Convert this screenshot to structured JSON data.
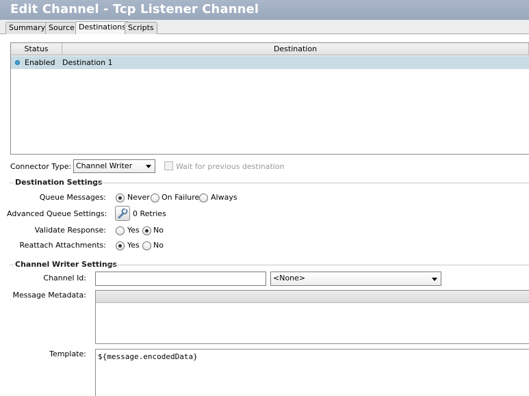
{
  "window": {
    "title": "Edit Channel - Tcp Listener Channel"
  },
  "tabs": [
    {
      "label": "Summary"
    },
    {
      "label": "Source"
    },
    {
      "label": "Destinations"
    },
    {
      "label": "Scripts"
    }
  ],
  "active_tab": "Destinations",
  "destinations_table": {
    "columns": [
      "Status",
      "Destination"
    ],
    "rows": [
      {
        "status": "Enabled",
        "destination": "Destination 1"
      }
    ]
  },
  "connector": {
    "label": "Connector Type:",
    "value": "Channel Writer",
    "wait_label": "Wait for previous destination"
  },
  "destination_settings": {
    "title": "Destination Settings",
    "queue_messages": {
      "label": "Queue Messages:",
      "options": [
        "Never",
        "On Failure",
        "Always"
      ],
      "selected": "Never"
    },
    "advanced_queue": {
      "label": "Advanced Queue Settings:",
      "value": "0 Retries"
    },
    "validate_response": {
      "label": "Validate Response:",
      "options": [
        "Yes",
        "No"
      ],
      "selected": "No"
    },
    "reattach_attachments": {
      "label": "Reattach Attachments:",
      "options": [
        "Yes",
        "No"
      ],
      "selected": "Yes"
    }
  },
  "channel_writer_settings": {
    "title": "Channel Writer Settings",
    "channel_id": {
      "label": "Channel Id:",
      "value": "",
      "select_value": "<None>"
    },
    "message_metadata": {
      "label": "Message Metadata:"
    },
    "template": {
      "label": "Template:",
      "value": "${message.encodedData}"
    }
  },
  "icons": {
    "status": "enabled-dot-icon",
    "advanced_queue": "wrench-icon",
    "dropdown": "chevron-down-icon"
  },
  "colors": {
    "title_bar": "#9aa8bc",
    "selected_row": "#c9dbe3",
    "status_dot": "#4aa3d8"
  }
}
